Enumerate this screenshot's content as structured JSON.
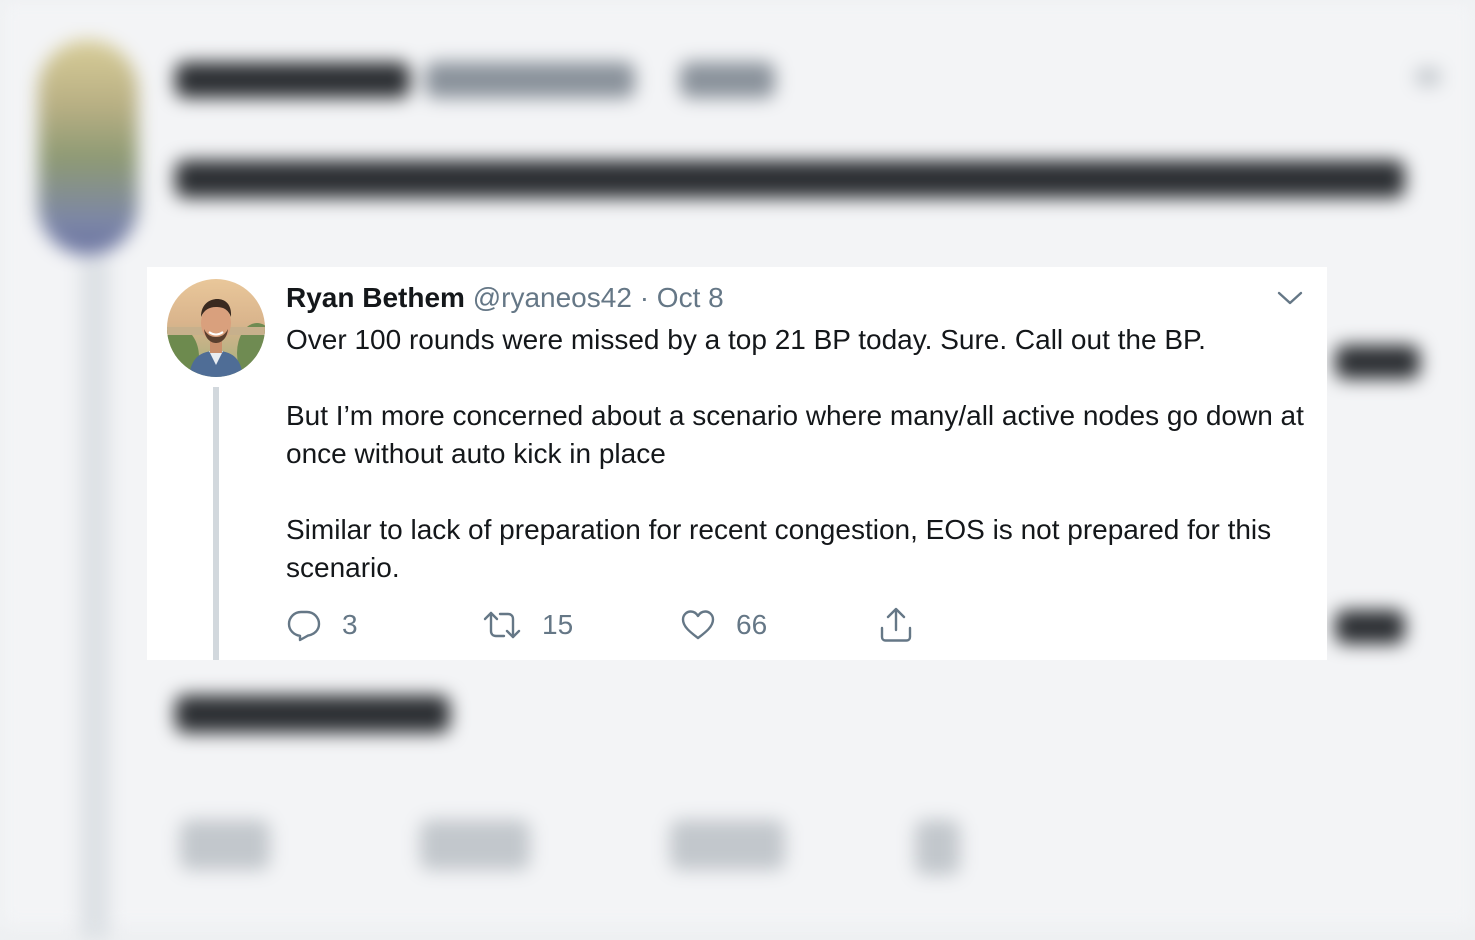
{
  "tweet": {
    "display_name": "Ryan Bethem",
    "handle": "@ryaneos42",
    "separator": "·",
    "date": "Oct 8",
    "paragraphs": [
      "Over 100 rounds were missed by a top 21 BP today. Sure. Call out the BP.",
      "But I’m more concerned about a scenario where many/all active nodes go down at once without auto kick in place",
      "Similar to lack of preparation for recent congestion, EOS is not prepared for this scenario."
    ],
    "actions": {
      "reply_count": "3",
      "retweet_count": "15",
      "like_count": "66"
    }
  },
  "icons": {
    "reply": "reply-icon",
    "retweet": "retweet-icon",
    "like": "heart-icon",
    "share": "share-icon",
    "menu": "chevron-down-icon"
  },
  "colors": {
    "text_primary": "#14171a",
    "text_secondary": "#657786",
    "thread_line": "#d2d8dd"
  }
}
